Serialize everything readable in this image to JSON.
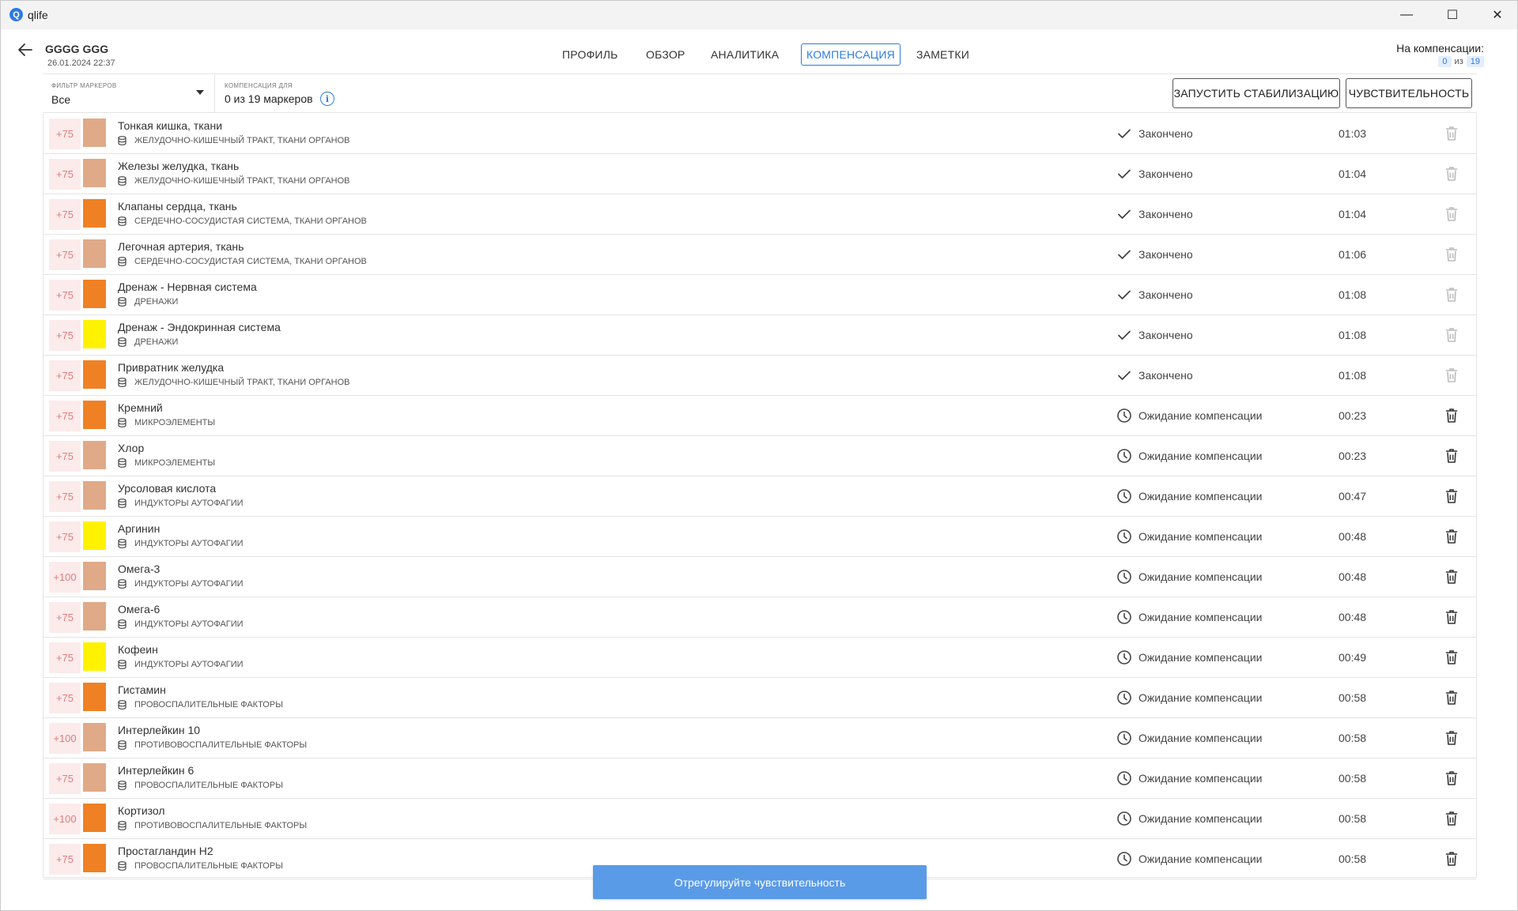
{
  "window": {
    "app_title": "qlife",
    "minimize": "—",
    "maximize": "☐",
    "close": "✕"
  },
  "header": {
    "patient_name": "GGGG GGG",
    "patient_date": "26.01.2024 22:37",
    "tabs": [
      {
        "label": "ПРОФИЛЬ",
        "active": false
      },
      {
        "label": "ОБЗОР",
        "active": false
      },
      {
        "label": "АНАЛИТИКА",
        "active": false
      },
      {
        "label": "КОМПЕНСАЦИЯ",
        "active": true
      },
      {
        "label": "ЗАМЕТКИ",
        "active": false
      }
    ],
    "compensation_label": "На компенсации:",
    "compensation_current": "0",
    "compensation_of": "из",
    "compensation_total": "19"
  },
  "toolbar": {
    "filter_caption": "ФИЛЬТР МАРКЕРОВ",
    "filter_value": "Все",
    "comp_for_caption": "КОМПЕНСАЦИЯ ДЛЯ",
    "comp_for_value": "0 из 19 маркеров",
    "start_stabilization": "ЗАПУСТИТЬ СТАБИЛИЗАЦИЮ",
    "sensitivity": "ЧУВСТВИТЕЛЬНОСТЬ"
  },
  "colors": {
    "accent": "#2a7de1",
    "peach": "#e0aa88",
    "orange": "#ef8124",
    "yellow": "#fff200",
    "score_bg": "#fcebeb",
    "score_text": "#e27b7b"
  },
  "rows": [
    {
      "score": "+75",
      "color": "peach",
      "name": "Тонкая кишка, ткани",
      "category": "ЖЕЛУДОЧНО-КИШЕЧНЫЙ ТРАКТ, ТКАНИ ОРГАНОВ",
      "status": "Закончено",
      "status_icon": "check-icon",
      "time": "01:03",
      "trash_enabled": false
    },
    {
      "score": "+75",
      "color": "peach",
      "name": "Железы желудка, ткань",
      "category": "ЖЕЛУДОЧНО-КИШЕЧНЫЙ ТРАКТ, ТКАНИ ОРГАНОВ",
      "status": "Закончено",
      "status_icon": "check-icon",
      "time": "01:04",
      "trash_enabled": false
    },
    {
      "score": "+75",
      "color": "orange",
      "name": "Клапаны сердца, ткань",
      "category": "СЕРДЕЧНО-СОСУДИСТАЯ СИСТЕМА, ТКАНИ ОРГАНОВ",
      "status": "Закончено",
      "status_icon": "check-icon",
      "time": "01:04",
      "trash_enabled": false
    },
    {
      "score": "+75",
      "color": "peach",
      "name": "Легочная артерия, ткань",
      "category": "СЕРДЕЧНО-СОСУДИСТАЯ СИСТЕМА, ТКАНИ ОРГАНОВ",
      "status": "Закончено",
      "status_icon": "check-icon",
      "time": "01:06",
      "trash_enabled": false
    },
    {
      "score": "+75",
      "color": "orange",
      "name": "Дренаж - Нервная система",
      "category": "ДРЕНАЖИ",
      "status": "Закончено",
      "status_icon": "check-icon",
      "time": "01:08",
      "trash_enabled": false
    },
    {
      "score": "+75",
      "color": "yellow",
      "name": "Дренаж - Эндокринная система",
      "category": "ДРЕНАЖИ",
      "status": "Закончено",
      "status_icon": "check-icon",
      "time": "01:08",
      "trash_enabled": false
    },
    {
      "score": "+75",
      "color": "orange",
      "name": "Привратник желудка",
      "category": "ЖЕЛУДОЧНО-КИШЕЧНЫЙ ТРАКТ, ТКАНИ ОРГАНОВ",
      "status": "Закончено",
      "status_icon": "check-icon",
      "time": "01:08",
      "trash_enabled": false
    },
    {
      "score": "+75",
      "color": "orange",
      "name": "Кремний",
      "category": "МИКРОЭЛЕМЕНТЫ",
      "status": "Ожидание компенсации",
      "status_icon": "clock-icon",
      "time": "00:23",
      "trash_enabled": true
    },
    {
      "score": "+75",
      "color": "peach",
      "name": "Хлор",
      "category": "МИКРОЭЛЕМЕНТЫ",
      "status": "Ожидание компенсации",
      "status_icon": "clock-icon",
      "time": "00:23",
      "trash_enabled": true
    },
    {
      "score": "+75",
      "color": "peach",
      "name": "Урсоловая кислота",
      "category": "ИНДУКТОРЫ АУТОФАГИИ",
      "status": "Ожидание компенсации",
      "status_icon": "clock-icon",
      "time": "00:47",
      "trash_enabled": true
    },
    {
      "score": "+75",
      "color": "yellow",
      "name": "Аргинин",
      "category": "ИНДУКТОРЫ АУТОФАГИИ",
      "status": "Ожидание компенсации",
      "status_icon": "clock-icon",
      "time": "00:48",
      "trash_enabled": true
    },
    {
      "score": "+100",
      "color": "peach",
      "name": "Омега-3",
      "category": "ИНДУКТОРЫ АУТОФАГИИ",
      "status": "Ожидание компенсации",
      "status_icon": "clock-icon",
      "time": "00:48",
      "trash_enabled": true
    },
    {
      "score": "+75",
      "color": "peach",
      "name": "Омега-6",
      "category": "ИНДУКТОРЫ АУТОФАГИИ",
      "status": "Ожидание компенсации",
      "status_icon": "clock-icon",
      "time": "00:48",
      "trash_enabled": true
    },
    {
      "score": "+75",
      "color": "yellow",
      "name": "Кофеин",
      "category": "ИНДУКТОРЫ АУТОФАГИИ",
      "status": "Ожидание компенсации",
      "status_icon": "clock-icon",
      "time": "00:49",
      "trash_enabled": true
    },
    {
      "score": "+75",
      "color": "orange",
      "name": "Гистамин",
      "category": "ПРОВОСПАЛИТЕЛЬНЫЕ ФАКТОРЫ",
      "status": "Ожидание компенсации",
      "status_icon": "clock-icon",
      "time": "00:58",
      "trash_enabled": true
    },
    {
      "score": "+100",
      "color": "peach",
      "name": "Интерлейкин 10",
      "category": "ПРОТИВОВОСПАЛИТЕЛЬНЫЕ ФАКТОРЫ",
      "status": "Ожидание компенсации",
      "status_icon": "clock-icon",
      "time": "00:58",
      "trash_enabled": true
    },
    {
      "score": "+75",
      "color": "peach",
      "name": "Интерлейкин 6",
      "category": "ПРОВОСПАЛИТЕЛЬНЫЕ ФАКТОРЫ",
      "status": "Ожидание компенсации",
      "status_icon": "clock-icon",
      "time": "00:58",
      "trash_enabled": true
    },
    {
      "score": "+100",
      "color": "orange",
      "name": "Кортизол",
      "category": "ПРОТИВОВОСПАЛИТЕЛЬНЫЕ ФАКТОРЫ",
      "status": "Ожидание компенсации",
      "status_icon": "clock-icon",
      "time": "00:58",
      "trash_enabled": true
    },
    {
      "score": "+75",
      "color": "orange",
      "name": "Простагландин Н2",
      "category": "ПРОВОСПАЛИТЕЛЬНЫЕ ФАКТОРЫ",
      "status": "Ожидание компенсации",
      "status_icon": "clock-icon",
      "time": "00:58",
      "trash_enabled": true
    }
  ],
  "footer": {
    "adjust_button": "Отрегулируйте чувствительность"
  }
}
